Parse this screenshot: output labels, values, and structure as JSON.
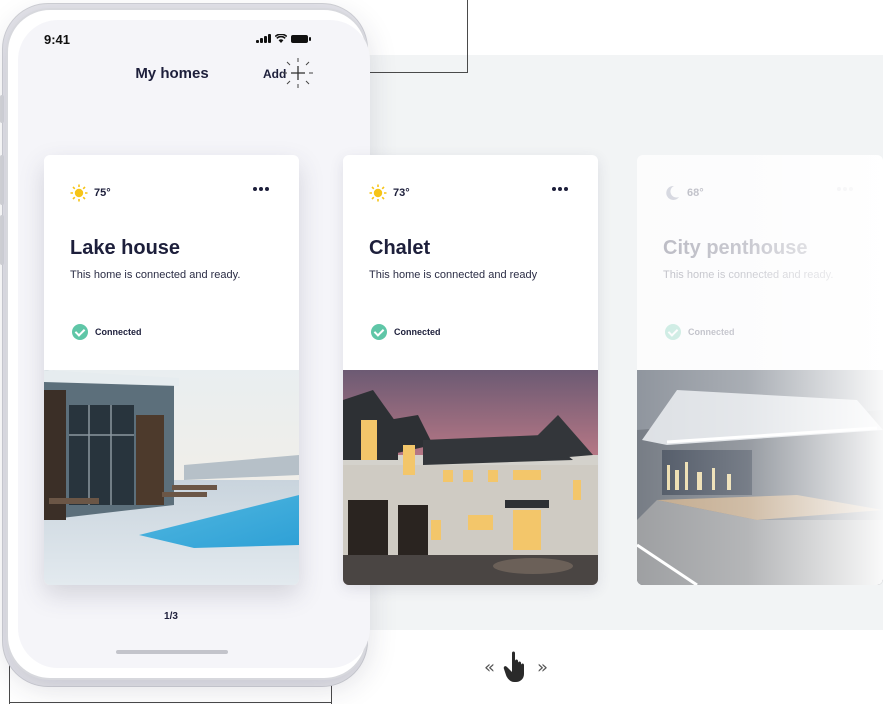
{
  "status_bar": {
    "time": "9:41"
  },
  "header": {
    "title": "My homes",
    "add_label": "Add"
  },
  "homes": [
    {
      "temperature": "75°",
      "weather_icon": "sun-icon",
      "name": "Lake house",
      "description": "This home is connected and ready.",
      "status": "Connected"
    },
    {
      "temperature": "73°",
      "weather_icon": "sun-icon",
      "name": "Chalet",
      "description": "This home is connected and ready",
      "status": "Connected"
    },
    {
      "temperature": "68°",
      "weather_icon": "moon-icon",
      "name": "City penthouse",
      "description": "This home is connected and ready.",
      "status": "Connected"
    }
  ],
  "pager": {
    "text": "1/3"
  },
  "swipe_hint": {
    "left": "«",
    "right": "»",
    "icon": "hand-pointer-icon"
  },
  "colors": {
    "accent_green": "#5fc6a7",
    "sun_yellow": "#f6c417",
    "text_dark": "#1d1f3b"
  }
}
